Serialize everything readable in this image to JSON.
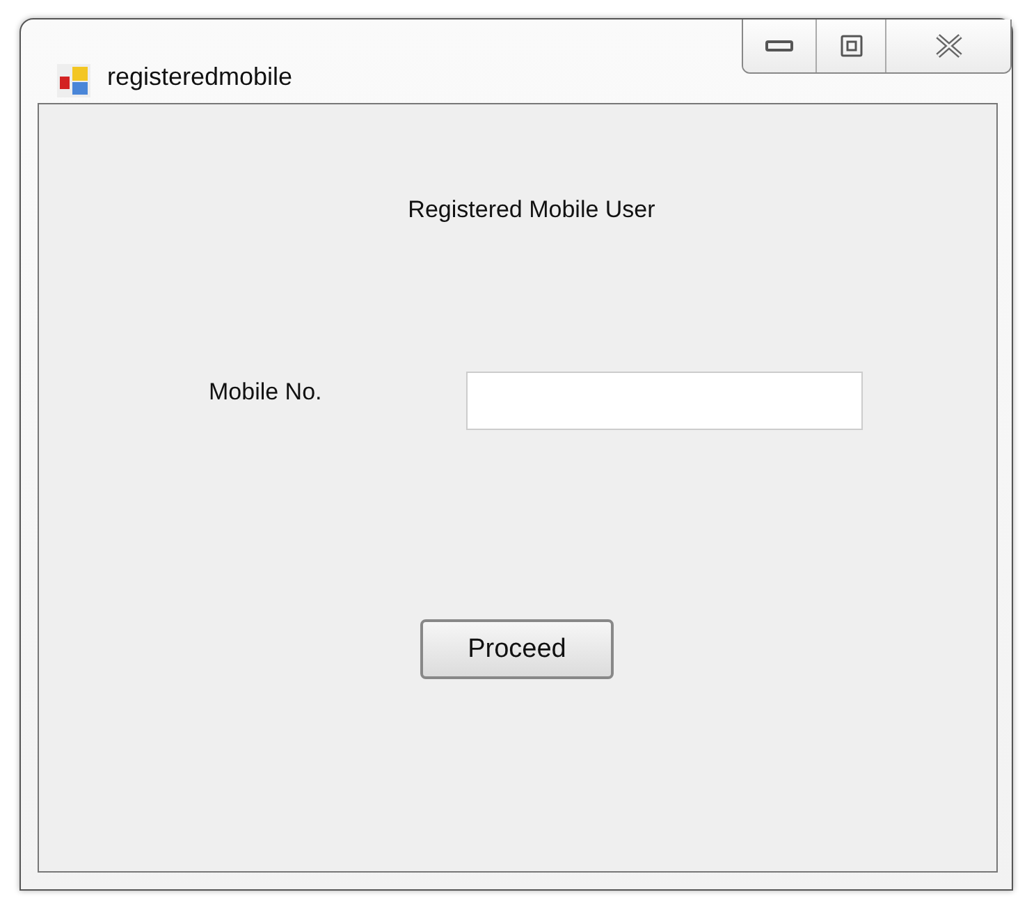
{
  "window": {
    "title": "registeredmobile"
  },
  "heading": "Registered Mobile User",
  "mobile_field": {
    "label": "Mobile No."
  },
  "buttons": [
    {
      "label": "Proceed"
    }
  ]
}
